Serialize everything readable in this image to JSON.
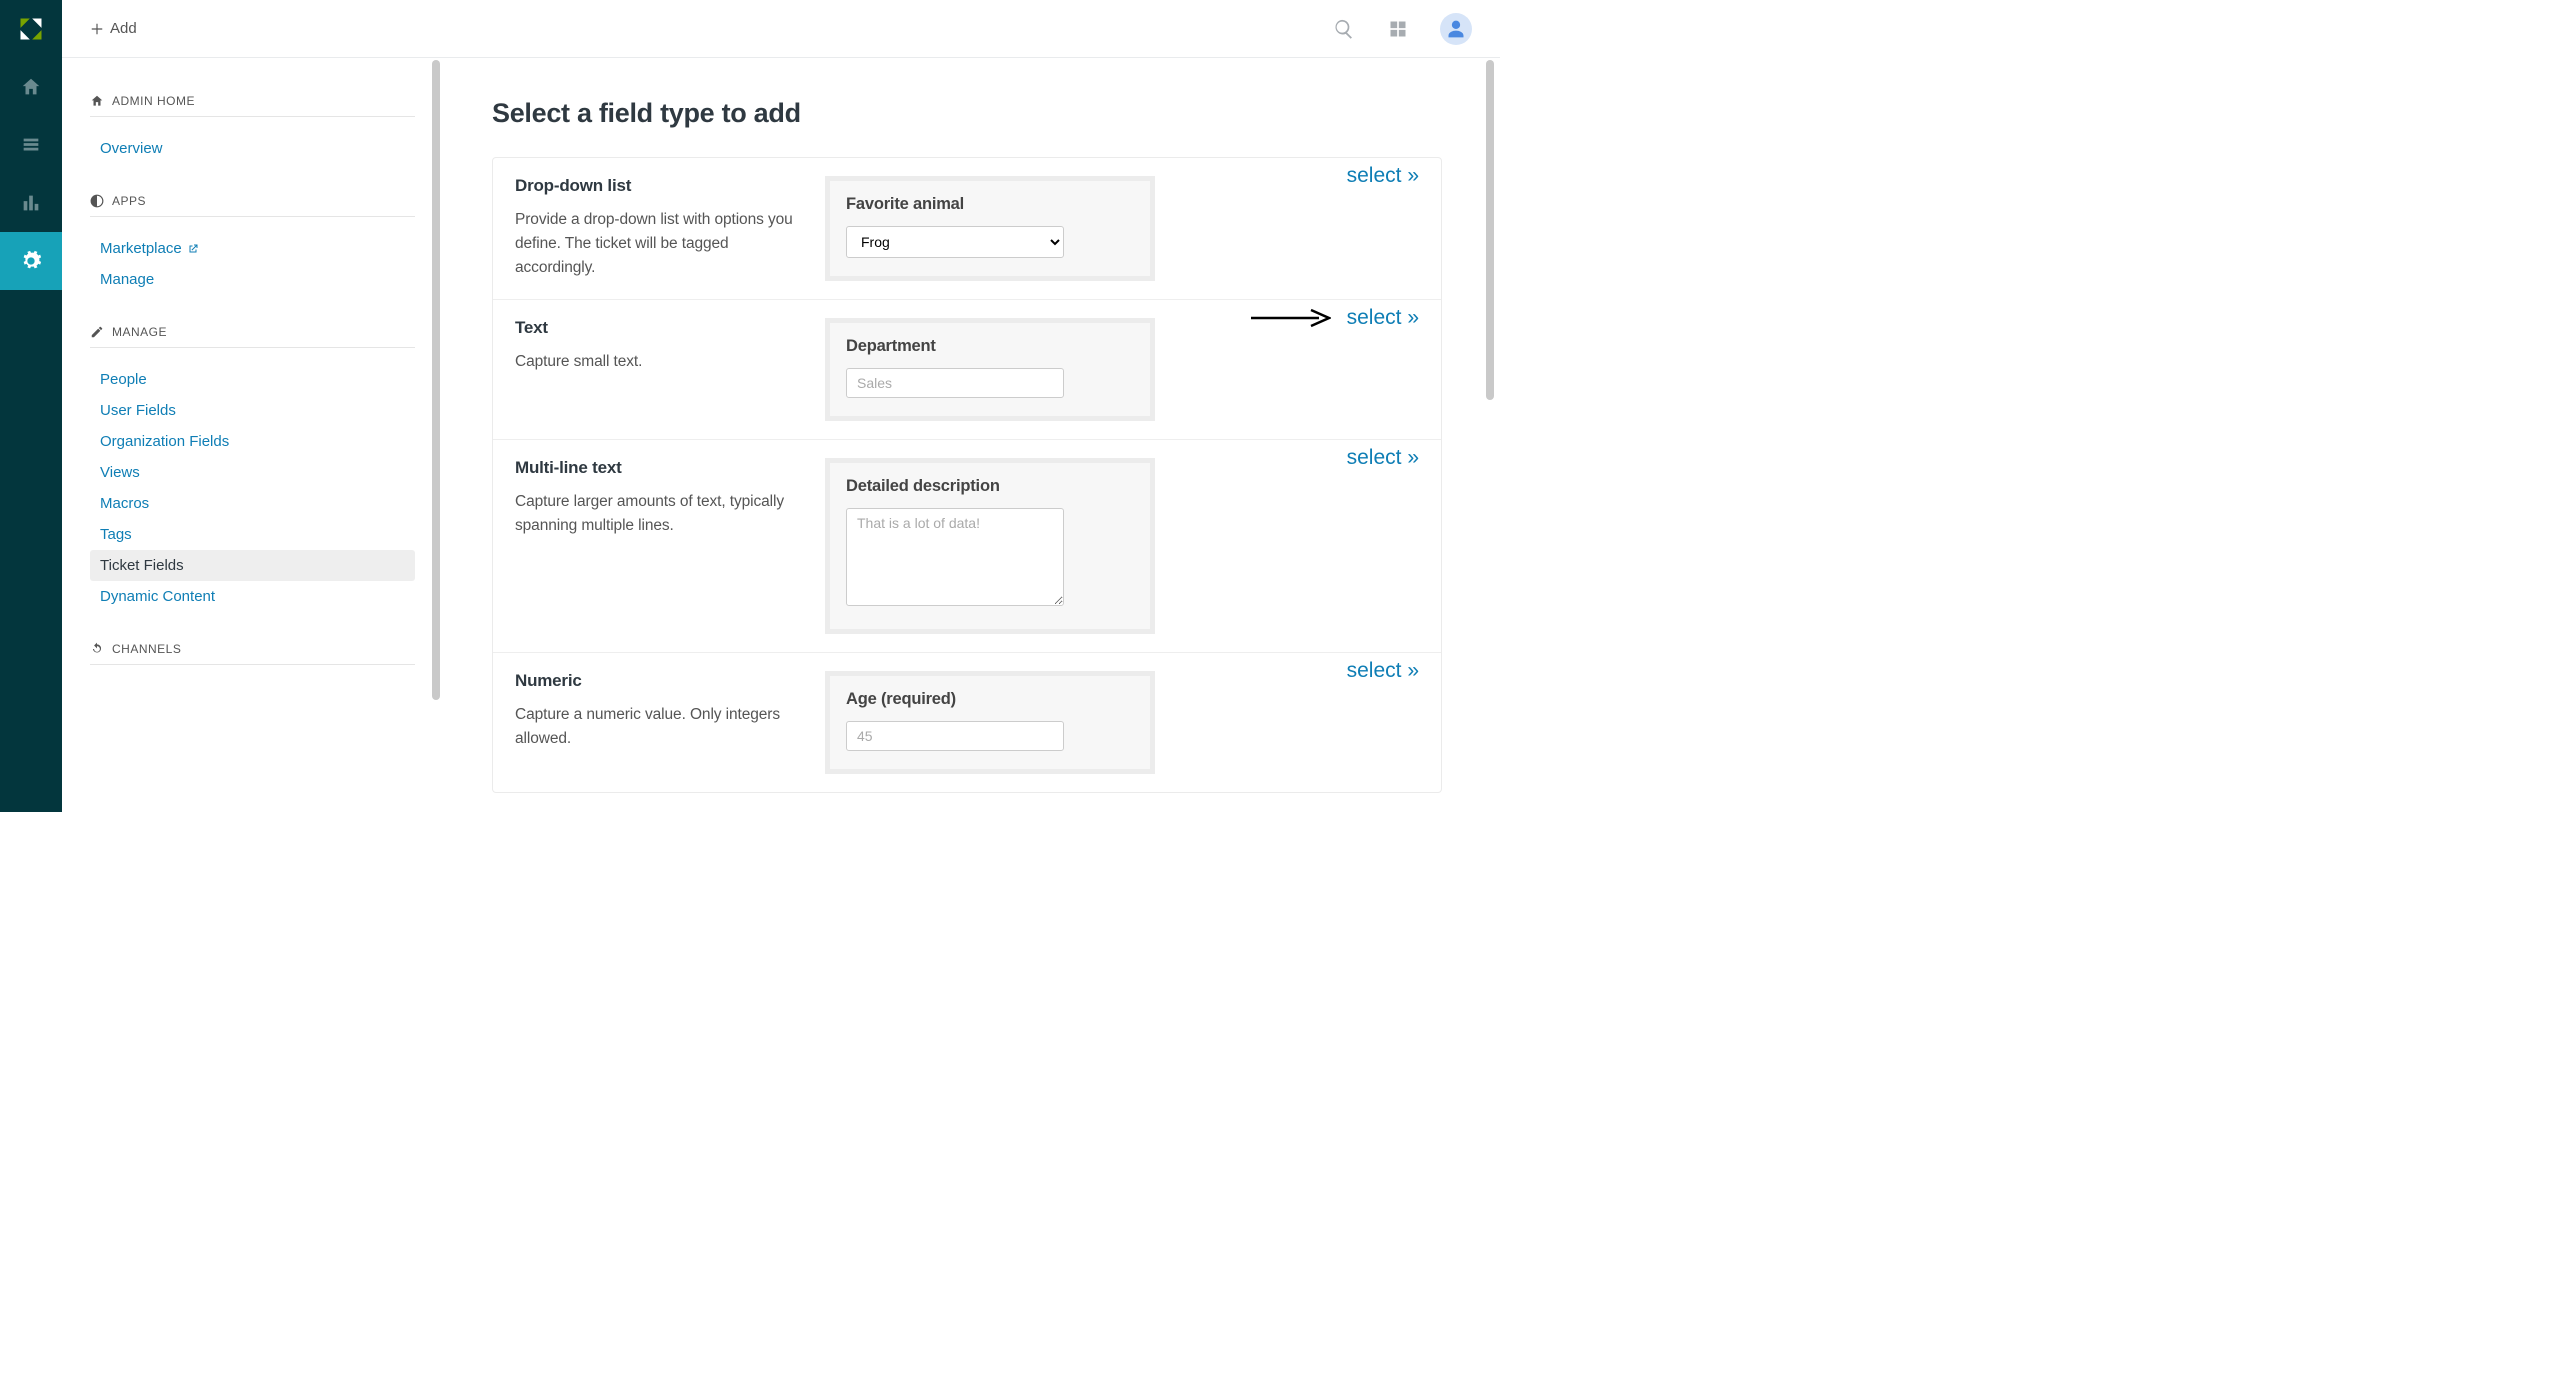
{
  "topbar": {
    "add_label": "Add"
  },
  "sidebar": {
    "sections": [
      {
        "title": "ADMIN HOME",
        "items": [
          {
            "label": "Overview"
          }
        ]
      },
      {
        "title": "APPS",
        "items": [
          {
            "label": "Marketplace",
            "external": true
          },
          {
            "label": "Manage"
          }
        ]
      },
      {
        "title": "MANAGE",
        "items": [
          {
            "label": "People"
          },
          {
            "label": "User Fields"
          },
          {
            "label": "Organization Fields"
          },
          {
            "label": "Views"
          },
          {
            "label": "Macros"
          },
          {
            "label": "Tags"
          },
          {
            "label": "Ticket Fields",
            "active": true
          },
          {
            "label": "Dynamic Content"
          }
        ]
      },
      {
        "title": "CHANNELS",
        "items": []
      }
    ]
  },
  "main": {
    "title": "Select a field type to add",
    "select_label": "select »",
    "fields": [
      {
        "name": "Drop-down list",
        "desc": "Provide a drop-down list with options you define. The ticket will be tagged accordingly.",
        "preview_label": "Favorite animal",
        "preview_value": "Frog"
      },
      {
        "name": "Text",
        "desc": "Capture small text.",
        "preview_label": "Department",
        "preview_placeholder": "Sales"
      },
      {
        "name": "Multi-line text",
        "desc": "Capture larger amounts of text, typically spanning multiple lines.",
        "preview_label": "Detailed description",
        "preview_placeholder": "That is a lot of data!"
      },
      {
        "name": "Numeric",
        "desc": "Capture a numeric value. Only integers allowed.",
        "preview_label": "Age (required)",
        "preview_placeholder": "45"
      }
    ]
  }
}
